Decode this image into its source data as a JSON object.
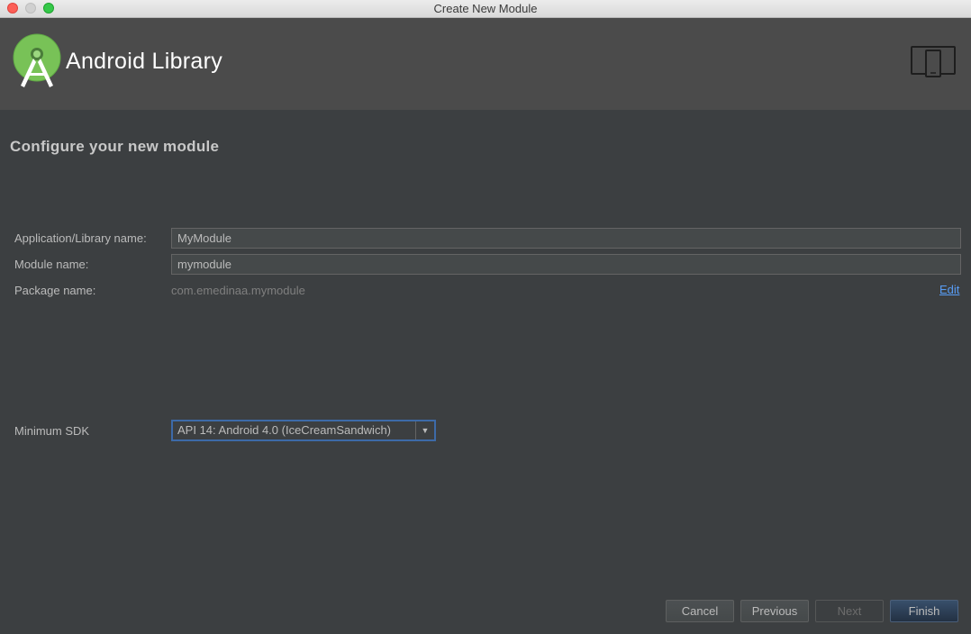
{
  "window": {
    "title": "Create New Module"
  },
  "header": {
    "title": "Android Library",
    "logo_icon": "android-studio-logo-icon",
    "device_icon": "tablet-phone-icon"
  },
  "main": {
    "section_title": "Configure your new module",
    "fields": {
      "app_name": {
        "label": "Application/Library name:",
        "value": "MyModule"
      },
      "module_name": {
        "label": "Module name:",
        "value": "mymodule"
      },
      "package_name": {
        "label": "Package name:",
        "value": "com.emedinaa.mymodule",
        "edit_label": "Edit"
      },
      "min_sdk": {
        "label": "Minimum SDK",
        "selected": "API 14: Android 4.0 (IceCreamSandwich)"
      }
    }
  },
  "buttons": {
    "cancel": "Cancel",
    "previous": "Previous",
    "next": "Next",
    "finish": "Finish"
  },
  "colors": {
    "background": "#3c3f41",
    "header": "#4b4b4b",
    "link": "#589df6",
    "focus": "#3d6aa8",
    "logo_green": "#78c257"
  }
}
